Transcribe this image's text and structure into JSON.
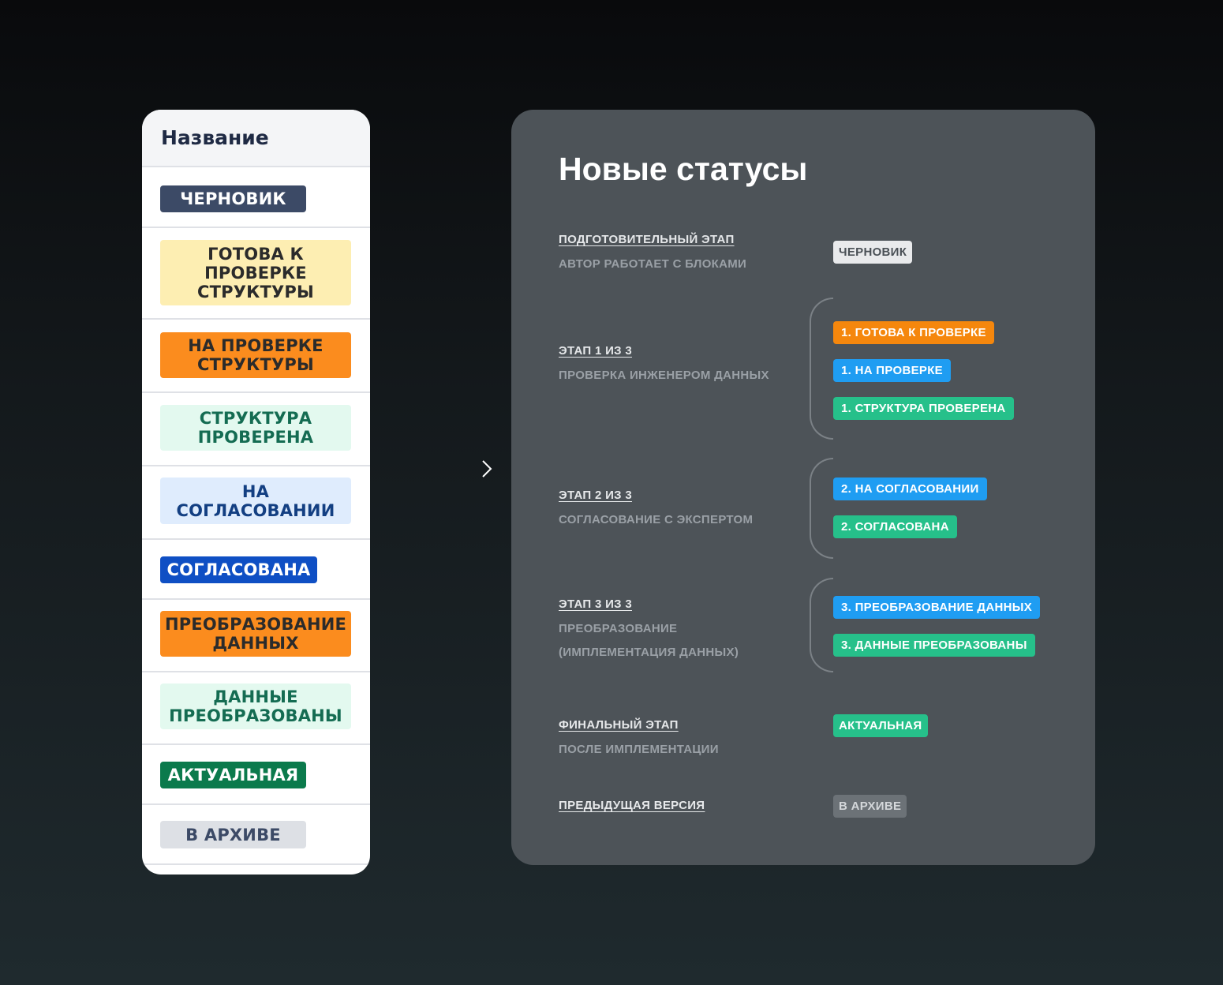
{
  "old_table": {
    "header": "Название",
    "statuses": [
      {
        "label": "Черновик",
        "bg": "#3c4a66",
        "fg": "#ffffff"
      },
      {
        "label": "Готова к проверке структуры",
        "bg": "#fdeeb2",
        "fg": "#2b2b2b"
      },
      {
        "label": "На проверке структуры",
        "bg": "#fb8c1e",
        "fg": "#2b2b2b"
      },
      {
        "label": "Структура проверена",
        "bg": "#e3f9ef",
        "fg": "#146c52"
      },
      {
        "label": "На согласовании",
        "bg": "#dfecfd",
        "fg": "#133f82"
      },
      {
        "label": "Согласована",
        "bg": "#0f4fc4",
        "fg": "#ffffff"
      },
      {
        "label": "Преобразование данных",
        "bg": "#fb8c1e",
        "fg": "#2b2b2b"
      },
      {
        "label": "Данные преобразованы",
        "bg": "#e3f9ef",
        "fg": "#146c52"
      },
      {
        "label": "Актуальная",
        "bg": "#0b7a4c",
        "fg": "#ffffff"
      },
      {
        "label": "В архиве",
        "bg": "#dde0e5",
        "fg": "#3c4a66"
      }
    ]
  },
  "panel": {
    "title": "Новые статусы",
    "stages": [
      {
        "title": "ПОДГОТОВИТЕЛЬНЫЙ ЭТАП",
        "desc": [
          "АВТОР РАБОТАЕТ С БЛОКАМИ"
        ],
        "statuses": [
          {
            "label": "ЧЕРНОВИК",
            "bg": "#e9eaec",
            "fg": "#4a5056"
          }
        ]
      },
      {
        "title": "ЭТАП 1 ИЗ 3",
        "desc": [
          "ПРОВЕРКА ИНЖЕНЕРОМ ДАННЫХ"
        ],
        "statuses": [
          {
            "label": "1. ГОТОВА К ПРОВЕРКЕ",
            "bg": "#f5870d",
            "fg": "#ffffff"
          },
          {
            "label": "1. НА ПРОВЕРКЕ",
            "bg": "#1f9df2",
            "fg": "#ffffff"
          },
          {
            "label": "1. СТРУКТУРА ПРОВЕРЕНА",
            "bg": "#26c08a",
            "fg": "#ffffff"
          }
        ]
      },
      {
        "title": "ЭТАП 2 ИЗ 3",
        "desc": [
          "СОГЛАСОВАНИЕ С ЭКСПЕРТОМ"
        ],
        "statuses": [
          {
            "label": "2. НА СОГЛАСОВАНИИ",
            "bg": "#1f9df2",
            "fg": "#ffffff"
          },
          {
            "label": "2. СОГЛАСОВАНА",
            "bg": "#26c08a",
            "fg": "#ffffff"
          }
        ]
      },
      {
        "title": "ЭТАП 3 ИЗ 3",
        "desc": [
          "ПРЕОБРАЗОВАНИЕ",
          "(ИМПЛЕМЕНТАЦИЯ ДАННЫХ)"
        ],
        "statuses": [
          {
            "label": "3. ПРЕОБРАЗОВАНИЕ ДАННЫХ",
            "bg": "#1f9df2",
            "fg": "#ffffff"
          },
          {
            "label": "3. ДАННЫЕ ПРЕОБРАЗОВАНЫ",
            "bg": "#26c08a",
            "fg": "#ffffff"
          }
        ]
      },
      {
        "title": "ФИНАЛЬНЫЙ ЭТАП",
        "desc": [
          "ПОСЛЕ ИМПЛЕМЕНТАЦИИ"
        ],
        "statuses": [
          {
            "label": "АКТУАЛЬНАЯ",
            "bg": "#26c08a",
            "fg": "#ffffff"
          }
        ]
      },
      {
        "title": "ПРЕДЫДУЩАЯ ВЕРСИЯ",
        "desc": [],
        "statuses": [
          {
            "label": "В АРХИВЕ",
            "bg": "#6c7277",
            "fg": "#d4d7da"
          }
        ]
      }
    ]
  }
}
